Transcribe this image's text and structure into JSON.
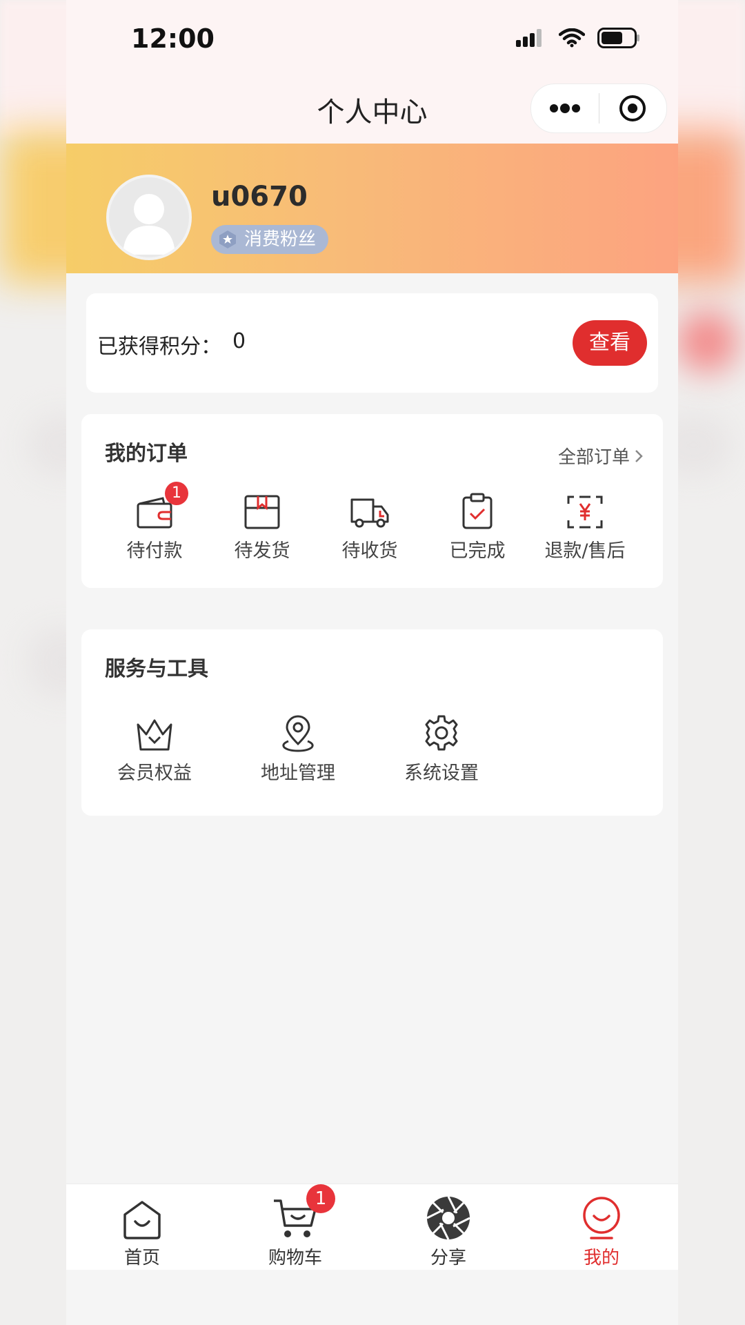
{
  "status_bar": {
    "time": "12:00"
  },
  "nav": {
    "title": "个人中心"
  },
  "profile": {
    "username": "u0670",
    "badge": "消费粉丝"
  },
  "points": {
    "label": "已获得积分：",
    "value": "0",
    "button": "查看"
  },
  "orders": {
    "title": "我的订单",
    "all_link": "全部订单",
    "items": [
      {
        "label": "待付款",
        "icon": "wallet-icon",
        "badge": "1"
      },
      {
        "label": "待发货",
        "icon": "package-icon"
      },
      {
        "label": "待收货",
        "icon": "truck-icon"
      },
      {
        "label": "已完成",
        "icon": "clipboard-check-icon"
      },
      {
        "label": "退款/售后",
        "icon": "refund-icon"
      }
    ]
  },
  "tools": {
    "title": "服务与工具",
    "items": [
      {
        "label": "会员权益",
        "icon": "crown-icon"
      },
      {
        "label": "地址管理",
        "icon": "location-icon"
      },
      {
        "label": "系统设置",
        "icon": "gear-icon"
      }
    ]
  },
  "tabbar": {
    "items": [
      {
        "label": "首页",
        "icon": "home-icon"
      },
      {
        "label": "购物车",
        "icon": "cart-icon",
        "badge": "1"
      },
      {
        "label": "分享",
        "icon": "aperture-icon"
      },
      {
        "label": "我的",
        "icon": "profile-icon",
        "active": true
      }
    ]
  },
  "colors": {
    "accent": "#e02e2e",
    "badge_red": "#e8343b",
    "gradient_start": "#f6cd68",
    "gradient_end": "#fca380"
  }
}
